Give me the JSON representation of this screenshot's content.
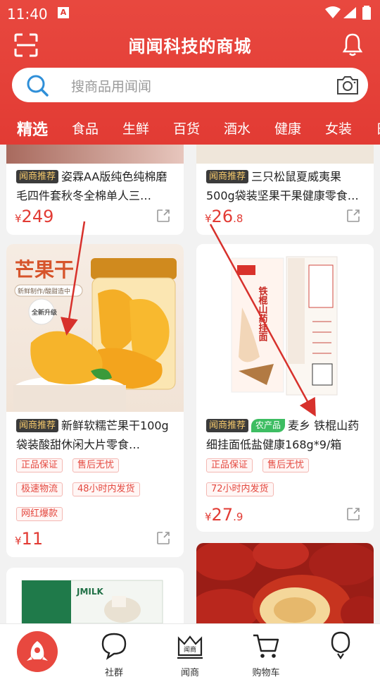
{
  "status": {
    "time": "11:40",
    "a_label": "A"
  },
  "header": {
    "title": "闻闻科技的商城",
    "search_placeholder": "搜商品用闻闻"
  },
  "tabs": [
    {
      "label": "精选"
    },
    {
      "label": "食品"
    },
    {
      "label": "生鲜"
    },
    {
      "label": "百货"
    },
    {
      "label": "酒水"
    },
    {
      "label": "健康"
    },
    {
      "label": "女装"
    },
    {
      "label": "日"
    }
  ],
  "cards": {
    "c1": {
      "tag": "闻商推荐",
      "title": "姿霖AA版纯色纯棉磨毛四件套秋冬全棉单人三…",
      "cur": "¥",
      "price": "249",
      "price_dec": ""
    },
    "c2": {
      "tag": "闻商推荐",
      "title": "三只松鼠夏威夷果500g袋装坚果干果健康零食…",
      "cur": "¥",
      "price": "26",
      "price_dec": ".8"
    },
    "c3": {
      "tag": "闻商推荐",
      "title": "新鲜软糯芒果干100g袋装酸甜休闲大片零食…",
      "badges": [
        "正品保证",
        "售后无忧",
        "极速物流",
        "48小时内发货",
        "网红爆款"
      ],
      "cur": "¥",
      "price": "11",
      "price_dec": "",
      "img_text1": "芒果干",
      "img_text2": "新鲜制作/酸甜造中",
      "img_text3": "全新升级"
    },
    "c4": {
      "tag": "闻商推荐",
      "farm_tag": "农产品",
      "title": "麦乡 铁棍山药细挂面低盐健康168g*9/箱",
      "badges": [
        "正品保证",
        "售后无忧",
        "72小时内发货"
      ],
      "cur": "¥",
      "price": "27",
      "price_dec": ".9",
      "pkg_text": "铁棍山药挂面"
    },
    "c5": {
      "img_text": "JMILK"
    }
  },
  "nav": [
    {
      "label": ""
    },
    {
      "label": "社群"
    },
    {
      "label": "闻商"
    },
    {
      "label": "购物车"
    },
    {
      "label": ""
    }
  ],
  "nav_icon_text": "闻商",
  "colors": {
    "brand": "#e23b34",
    "tag_bg": "#3b3b3b",
    "tag_fg": "#f6c96b",
    "farm": "#3dbd62",
    "arrow": "#d7312c"
  }
}
